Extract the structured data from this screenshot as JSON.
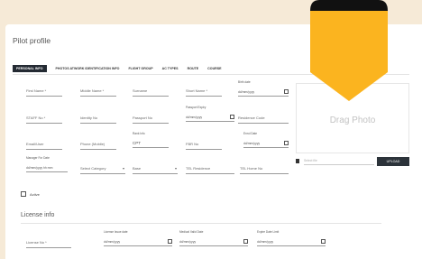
{
  "page": {
    "title": "Pilot profile"
  },
  "tabs": [
    {
      "label": "PERSONAL INFO",
      "active": true
    },
    {
      "label": "PHOTOS ATWORK IDENTIFICATION INFO",
      "active": false
    },
    {
      "label": "FLIGHT GROUP",
      "active": false
    },
    {
      "label": "AC TYPES",
      "active": false
    },
    {
      "label": "ROUTE",
      "active": false
    },
    {
      "label": "COURSE",
      "active": false
    }
  ],
  "fields": {
    "first_name": "First Name *",
    "middle_name": "Middle Name *",
    "surname": "Surname",
    "short_name": "Short Name *",
    "birth_date_label": "Birth date",
    "birth_date_val": "dd/mm/yyyy",
    "staff_no": "STAFF No *",
    "identity_no": "Identity No",
    "passport_no": "Passport No",
    "passport_expiry_label": "Passport Expiry",
    "passport_expiry_val": "dd/mm/yyyy",
    "residence_code": "Residence Code",
    "email": "Email/User",
    "phone": "Phone (Mobile)",
    "rank_label": "Rank Info",
    "rank_val": "CPT",
    "employee_no": "FBR No",
    "enrol_date_label": "Enrol Date",
    "enrol_date_val": "dd/mm/yyyy",
    "manager_label": "Manager For Date",
    "manager_val": "dd/mm/yyyy  hh:mm",
    "select_category": "Select Category",
    "base": "Base",
    "tel_residence": "TEL Residence",
    "tel_home": "TEL Home No",
    "active_label": "Active",
    "license_1_label": "License No *",
    "license_issue_label": "License Issue date",
    "license_issue_val": "dd/mm/yyyy",
    "medical_label": "Medical Valid Date",
    "medical_val": "dd/mm/yyyy",
    "expiry_label": "Expire Date Limit",
    "expiry_val": "dd/mm/yyyy"
  },
  "photo": {
    "drop_text": "Drag Photo",
    "file_placeholder": "Select file",
    "upload_label": "UPLOAD"
  },
  "license_section": {
    "title": "License info"
  },
  "colors": {
    "ribbon": "#fbb41f",
    "background": "#f6ead7",
    "upload_button": "#2c333a"
  }
}
